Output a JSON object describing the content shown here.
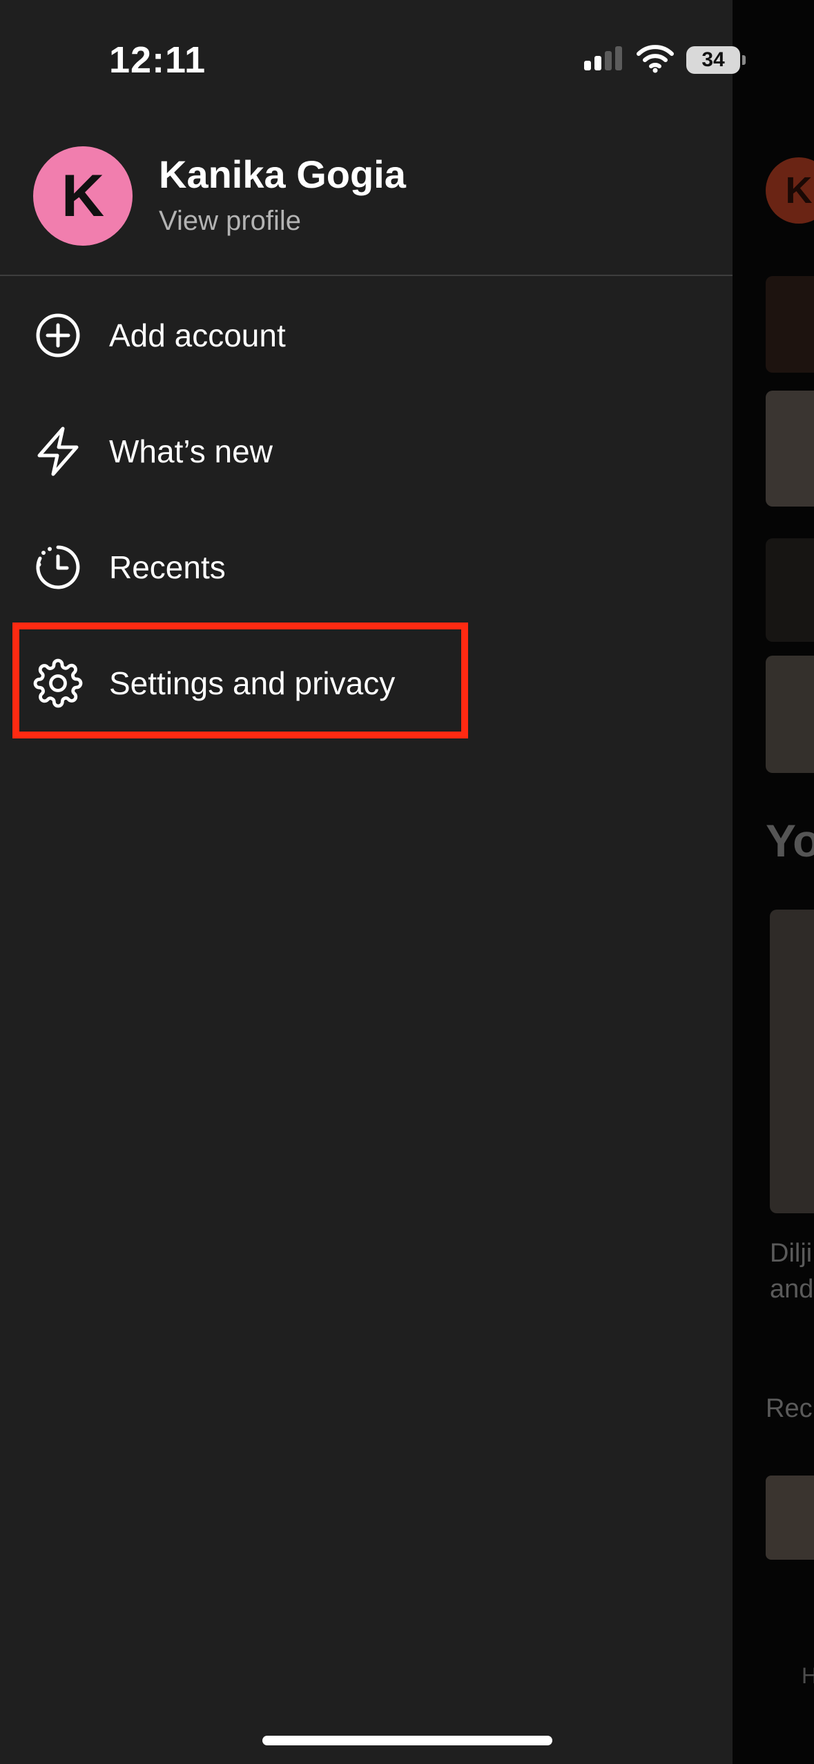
{
  "status_bar": {
    "time": "12:11",
    "battery": "34"
  },
  "profile": {
    "initial": "K",
    "name": "Kanika Gogia",
    "link": "View profile"
  },
  "menu": {
    "items": [
      {
        "label": "Add account",
        "icon": "add-circle-icon"
      },
      {
        "label": "What’s new",
        "icon": "lightning-icon"
      },
      {
        "label": "Recents",
        "icon": "history-clock-icon"
      },
      {
        "label": "Settings and privacy",
        "icon": "gear-icon"
      }
    ]
  },
  "background": {
    "avatar_initial": "K",
    "heading": "Yo",
    "card_text_line1": "Dilji",
    "card_text_line2": "and",
    "recents_label": "Rec",
    "nav_label": "H"
  },
  "colors": {
    "accent_highlight": "#ff2a12",
    "avatar_bg": "#f17eae",
    "drawer_bg": "#1f1f1f"
  }
}
